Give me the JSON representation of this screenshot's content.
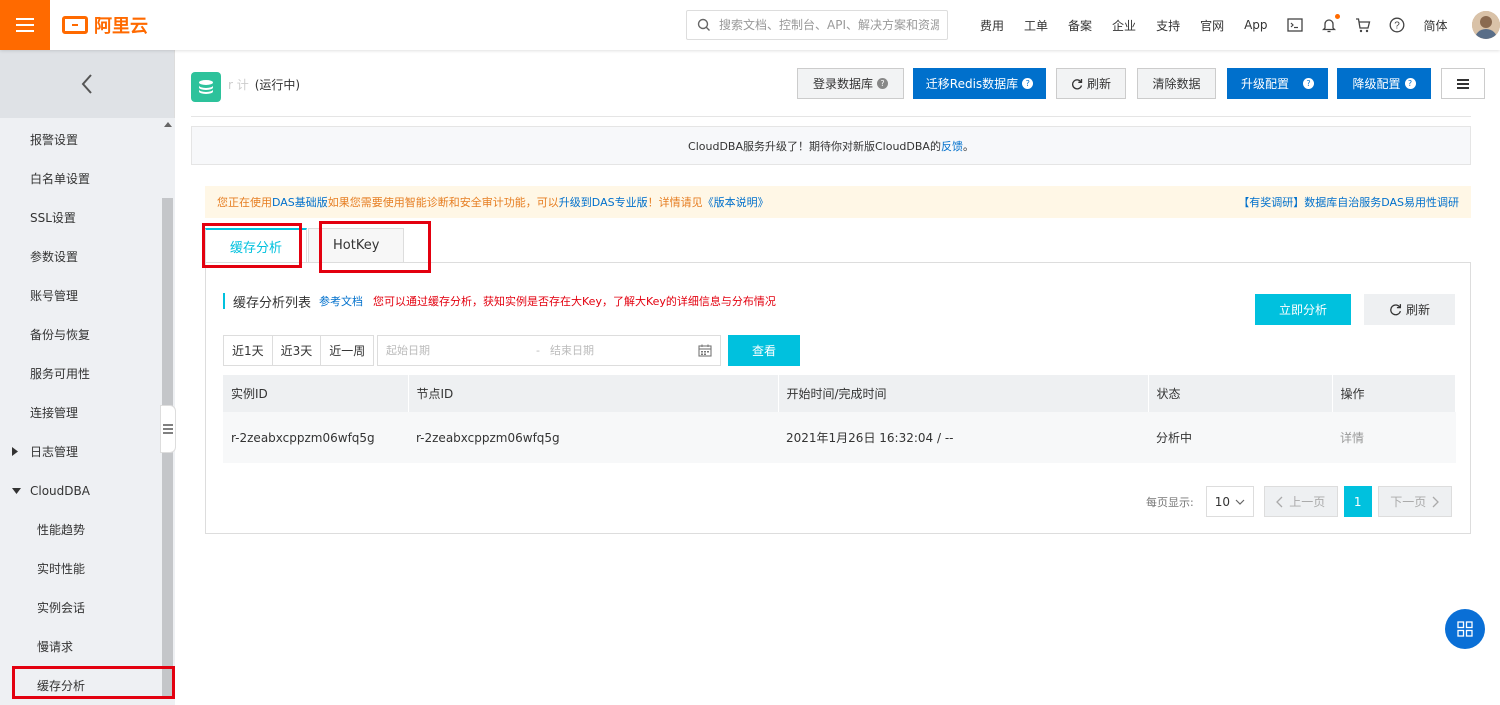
{
  "header": {
    "logo_text": "阿里云",
    "search_placeholder": "搜索文档、控制台、API、解决方案和资源",
    "nav": [
      "费用",
      "工单",
      "备案",
      "企业",
      "支持",
      "官网",
      "App"
    ],
    "lang": "简体",
    "accent": "#ff6a00"
  },
  "sidebar": {
    "items": [
      {
        "label": "报警设置",
        "type": "item"
      },
      {
        "label": "白名单设置",
        "type": "item"
      },
      {
        "label": "SSL设置",
        "type": "item"
      },
      {
        "label": "参数设置",
        "type": "item"
      },
      {
        "label": "账号管理",
        "type": "item"
      },
      {
        "label": "备份与恢复",
        "type": "item"
      },
      {
        "label": "服务可用性",
        "type": "item"
      },
      {
        "label": "连接管理",
        "type": "item"
      },
      {
        "label": "日志管理",
        "type": "collapsed-group"
      },
      {
        "label": "CloudDBA",
        "type": "expanded-group"
      },
      {
        "label": "性能趋势",
        "type": "sub"
      },
      {
        "label": "实时性能",
        "type": "sub"
      },
      {
        "label": "实例会话",
        "type": "sub"
      },
      {
        "label": "慢请求",
        "type": "sub"
      },
      {
        "label": "缓存分析",
        "type": "sub"
      }
    ]
  },
  "instance": {
    "name_masked": "r  计",
    "status": "(运行中)"
  },
  "toolbar": {
    "login_db": "登录数据库",
    "migrate_redis": "迁移Redis数据库",
    "refresh": "刷新",
    "clear_data": "清除数据",
    "upgrade": "升级配置",
    "downgrade": "降级配置"
  },
  "notice": {
    "text": "CloudDBA服务升级了！期待你对新版CloudDBA的",
    "link": "反馈",
    "end": "。"
  },
  "warning": {
    "p1": "您正在使用",
    "link1": "DAS基础版",
    "p2": "如果您需要使用智能诊断和安全审计功能，可以",
    "link2": "升级到DAS专业版",
    "p3": "！详情请见",
    "link3": "《版本说明》",
    "right": "【有奖调研】数据库自治服务DAS易用性调研"
  },
  "tabs": [
    {
      "label": "缓存分析",
      "active": true
    },
    {
      "label": "HotKey",
      "active": false
    }
  ],
  "panel": {
    "title": "缓存分析列表",
    "ref_link": "参考文档",
    "hint": "您可以通过缓存分析，获知实例是否存在大Key，了解大Key的详细信息与分布情况",
    "analyze_button": "立即分析",
    "refresh_button": "刷新",
    "ranges": [
      "近1天",
      "近3天",
      "近一周"
    ],
    "start_placeholder": "起始日期",
    "end_placeholder": "结束日期",
    "query_button": "查看"
  },
  "table": {
    "columns": [
      "实例ID",
      "节点ID",
      "开始时间/完成时间",
      "状态",
      "操作"
    ],
    "rows": [
      [
        "r-2zeabxcppzm06wfq5g",
        "r-2zeabxcppzm06wfq5g",
        "2021年1月26日 16:32:04 / --",
        "分析中",
        "详情"
      ]
    ]
  },
  "pagination": {
    "page_size_label": "每页显示:",
    "page_size": "10",
    "prev": "上一页",
    "current": "1",
    "next": "下一页"
  }
}
